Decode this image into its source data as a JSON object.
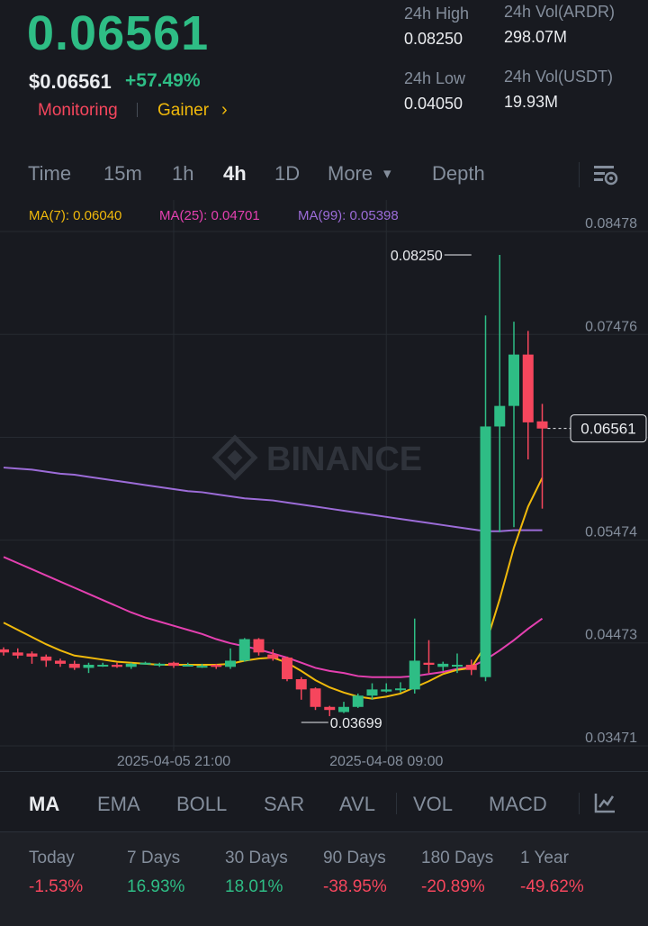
{
  "header": {
    "price": "0.06561",
    "price_usd": "$0.06561",
    "change_pct": "+57.49%",
    "tag_monitoring": "Monitoring",
    "tag_gainer": "Gainer",
    "tag_chevron": "›"
  },
  "stats": {
    "high_label": "24h High",
    "high_value": "0.08250",
    "low_label": "24h Low",
    "low_value": "0.04050",
    "vol_base_label": "24h Vol(ARDR)",
    "vol_base_value": "298.07M",
    "vol_quote_label": "24h Vol(USDT)",
    "vol_quote_value": "19.93M"
  },
  "tabs": {
    "time": "Time",
    "m15": "15m",
    "h1": "1h",
    "h4": "4h",
    "d1": "1D",
    "more": "More",
    "more_caret": "▾",
    "depth": "Depth"
  },
  "ma_legend": {
    "ma7": "MA(7): 0.06040",
    "ma25": "MA(25): 0.04701",
    "ma99": "MA(99): 0.05398"
  },
  "colors": {
    "up": "#2ebd85",
    "down": "#f6465d",
    "ma7": "#f0b90b",
    "ma25": "#e440b0",
    "ma99": "#9c6cd8"
  },
  "chart_data": {
    "type": "candlestick",
    "y_ticks": [
      "0.08478",
      "0.07476",
      "0.06561",
      "0.05474",
      "0.04473",
      "0.03471"
    ],
    "y_tick_values": [
      0.08478,
      0.07476,
      0.06474,
      0.05474,
      0.04473,
      0.03471
    ],
    "ylim": [
      0.03471,
      0.08478
    ],
    "x_labels": [
      "2025-04-05 21:00",
      "2025-04-08 09:00"
    ],
    "x_label_candle_index": [
      12,
      27
    ],
    "current_price": 0.06561,
    "current_price_label": "0.06561",
    "high_marker": {
      "label": "0.08250",
      "value": 0.0825,
      "candle_index": 33
    },
    "low_marker": {
      "label": "0.03699",
      "value": 0.03699,
      "candle_index": 21
    },
    "watermark": "BINANCE",
    "candles": [
      [
        0.0441,
        0.0438,
        0.0443,
        0.0435
      ],
      [
        0.0438,
        0.0435,
        0.0442,
        0.0432
      ],
      [
        0.0437,
        0.0434,
        0.0439,
        0.0427
      ],
      [
        0.0434,
        0.043,
        0.0436,
        0.0424
      ],
      [
        0.043,
        0.0427,
        0.0432,
        0.0424
      ],
      [
        0.0427,
        0.0423,
        0.043,
        0.0421
      ],
      [
        0.0423,
        0.0426,
        0.0428,
        0.0418
      ],
      [
        0.0425,
        0.0426,
        0.0428,
        0.0424
      ],
      [
        0.0426,
        0.0424,
        0.0428,
        0.0423
      ],
      [
        0.0424,
        0.0427,
        0.0428,
        0.0422
      ],
      [
        0.0427,
        0.0428,
        0.0429,
        0.0426
      ],
      [
        0.0427,
        0.0427,
        0.0428,
        0.0424
      ],
      [
        0.0428,
        0.0425,
        0.0429,
        0.0423
      ],
      [
        0.0426,
        0.0426,
        0.0428,
        0.0425
      ],
      [
        0.0425,
        0.0425,
        0.0427,
        0.0423
      ],
      [
        0.0426,
        0.0424,
        0.0427,
        0.0422
      ],
      [
        0.0424,
        0.043,
        0.0442,
        0.0422
      ],
      [
        0.043,
        0.0451,
        0.0452,
        0.0429
      ],
      [
        0.0451,
        0.0438,
        0.0452,
        0.0435
      ],
      [
        0.0436,
        0.0432,
        0.0441,
        0.043
      ],
      [
        0.0433,
        0.0412,
        0.0434,
        0.041
      ],
      [
        0.0412,
        0.0402,
        0.0414,
        0.0392
      ],
      [
        0.0403,
        0.0385,
        0.0404,
        0.0382
      ],
      [
        0.0385,
        0.0382,
        0.0386,
        0.0376
      ],
      [
        0.038,
        0.0385,
        0.039,
        0.0379
      ],
      [
        0.0385,
        0.0396,
        0.0398,
        0.0384
      ],
      [
        0.0396,
        0.0402,
        0.0408,
        0.0392
      ],
      [
        0.04,
        0.0402,
        0.0408,
        0.0399
      ],
      [
        0.0403,
        0.0403,
        0.0409,
        0.0399
      ],
      [
        0.0402,
        0.043,
        0.0471,
        0.0398
      ],
      [
        0.0428,
        0.0426,
        0.045,
        0.0418
      ],
      [
        0.0424,
        0.0427,
        0.0429,
        0.042
      ],
      [
        0.0425,
        0.0426,
        0.0437,
        0.0418
      ],
      [
        0.0426,
        0.0421,
        0.0431,
        0.0416
      ],
      [
        0.0414,
        0.0658,
        0.0766,
        0.041
      ],
      [
        0.0658,
        0.0678,
        0.0825,
        0.0555
      ],
      [
        0.0678,
        0.0728,
        0.076,
        0.056
      ],
      [
        0.0728,
        0.0662,
        0.0751,
        0.0626
      ],
      [
        0.0663,
        0.0656,
        0.068,
        0.0578
      ]
    ],
    "ma7": [
      0.0467,
      0.046,
      0.0453,
      0.0446,
      0.044,
      0.0435,
      0.0433,
      0.0431,
      0.0429,
      0.0428,
      0.0427,
      0.0426,
      0.0426,
      0.0426,
      0.0426,
      0.0426,
      0.0427,
      0.043,
      0.0432,
      0.0433,
      0.0428,
      0.042,
      0.0411,
      0.0404,
      0.0399,
      0.0395,
      0.0393,
      0.0395,
      0.0398,
      0.0404,
      0.041,
      0.0417,
      0.0421,
      0.0423,
      0.0445,
      0.049,
      0.054,
      0.058,
      0.0608
    ],
    "ma25": [
      0.0531,
      0.0525,
      0.0519,
      0.0513,
      0.0507,
      0.0501,
      0.0495,
      0.0489,
      0.0483,
      0.0477,
      0.0472,
      0.0468,
      0.0464,
      0.046,
      0.0456,
      0.0451,
      0.0447,
      0.0444,
      0.0441,
      0.0437,
      0.0433,
      0.0428,
      0.0423,
      0.042,
      0.0418,
      0.0415,
      0.0414,
      0.0414,
      0.0414,
      0.0415,
      0.0417,
      0.0419,
      0.0422,
      0.0424,
      0.0431,
      0.044,
      0.045,
      0.0461,
      0.0471
    ],
    "ma99": [
      0.0618,
      0.0617,
      0.0616,
      0.0614,
      0.0612,
      0.0611,
      0.0609,
      0.0607,
      0.0605,
      0.0603,
      0.0601,
      0.0599,
      0.0597,
      0.0595,
      0.0594,
      0.0592,
      0.059,
      0.0588,
      0.0587,
      0.0586,
      0.0584,
      0.0582,
      0.058,
      0.0578,
      0.0576,
      0.0574,
      0.0572,
      0.057,
      0.0568,
      0.0566,
      0.0564,
      0.0562,
      0.056,
      0.0558,
      0.0556,
      0.0556,
      0.0557,
      0.0557,
      0.0557
    ]
  },
  "indicators": {
    "ma": "MA",
    "ema": "EMA",
    "boll": "BOLL",
    "sar": "SAR",
    "avl": "AVL",
    "vol": "VOL",
    "macd": "MACD"
  },
  "performance": [
    {
      "label": "Today",
      "value": "-1.53%",
      "dir": "neg"
    },
    {
      "label": "7 Days",
      "value": "16.93%",
      "dir": "pos"
    },
    {
      "label": "30 Days",
      "value": "18.01%",
      "dir": "pos"
    },
    {
      "label": "90 Days",
      "value": "-38.95%",
      "dir": "neg"
    },
    {
      "label": "180 Days",
      "value": "-20.89%",
      "dir": "neg"
    },
    {
      "label": "1 Year",
      "value": "-49.62%",
      "dir": "neg"
    }
  ]
}
